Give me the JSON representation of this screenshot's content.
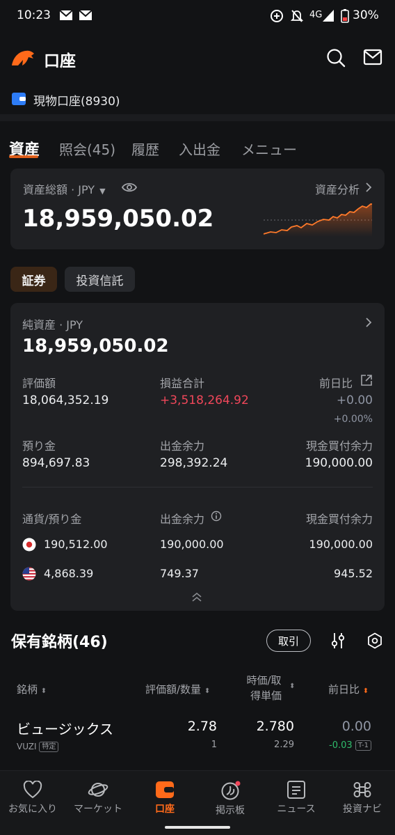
{
  "status_bar": {
    "time": "10:23",
    "network": "4G",
    "battery": "30%"
  },
  "header": {
    "title": "口座",
    "account": "現物口座(8930)"
  },
  "tabs": [
    {
      "label": "資産"
    },
    {
      "label": "照会(45)"
    },
    {
      "label": "履歴"
    },
    {
      "label": "入出金"
    },
    {
      "label": "メニュー"
    }
  ],
  "asset_summary": {
    "label": "資産総額 · JPY",
    "value": "18,959,050.02",
    "analysis_link": "資産分析"
  },
  "segments": {
    "securities": "証券",
    "funds": "投資信託"
  },
  "net_assets": {
    "label": "純資産 · JPY",
    "value": "18,959,050.02",
    "valuation_label": "評価額",
    "valuation": "18,064,352.19",
    "pl_label": "損益合計",
    "pl": "+3,518,264.92",
    "day_change_label": "前日比",
    "day_change": "+0.00",
    "day_change_pct": "+0.00%",
    "deposit_label": "預り金",
    "deposit": "894,697.83",
    "withdrawable_label": "出金余力",
    "withdrawable": "298,392.24",
    "cash_buying_label": "現金買付余力",
    "cash_buying": "190,000.00"
  },
  "currency_table": {
    "headers": [
      "通貨/預り金",
      "出金余力",
      "現金買付余力"
    ],
    "rows": [
      {
        "flag": "jp-flag",
        "deposit": "190,512.00",
        "withdrawable": "190,000.00",
        "buying": "190,000.00"
      },
      {
        "flag": "us-flag",
        "deposit": "4,868.39",
        "withdrawable": "749.37",
        "buying": "945.52"
      }
    ]
  },
  "holdings": {
    "title": "保有銘柄(46)",
    "trade_button": "取引",
    "columns": {
      "name": "銘柄",
      "value_qty": "評価額/数量",
      "price_line1": "時価/取",
      "price_line2": "得単価",
      "change": "前日比"
    },
    "rows": [
      {
        "name": "ビュージックス",
        "ticker": "VUZI",
        "badge": "特定",
        "value": "2.78",
        "qty": "1",
        "price": "2.780",
        "cost": "2.29",
        "change": "0.00",
        "change_amt": "-0.03",
        "settle": "T-1"
      }
    ]
  },
  "bottom_nav": [
    {
      "label": "お気に入り"
    },
    {
      "label": "マーケット"
    },
    {
      "label": "口座"
    },
    {
      "label": "掲示板"
    },
    {
      "label": "ニュース"
    },
    {
      "label": "投資ナビ"
    }
  ],
  "colors": {
    "accent": "#ff6a1a",
    "loss_red": "#f0475a",
    "gain_green": "#2fbd6c",
    "background": "#121315",
    "card": "#1f2023"
  }
}
